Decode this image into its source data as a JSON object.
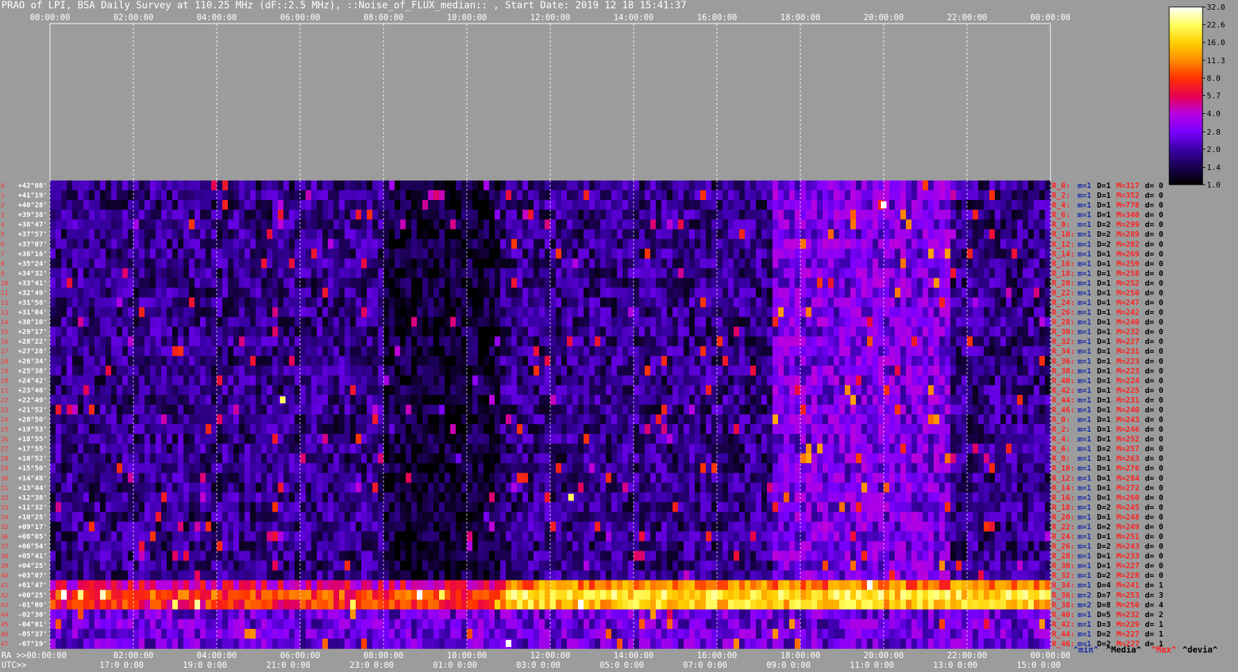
{
  "title": "PRAO of LPI, BSA Daily Survey at 110.25 MHz (dF::2.5 MHz), ::Noise_of_FLUX_median:: , Start Date: 2019 12 18 15:41:37",
  "chart_data": {
    "type": "heatmap",
    "title": "PRAO of LPI, BSA Daily Survey at 110.25 MHz (dF::2.5 MHz), ::Noise_of_FLUX_median:: , Start Date: 2019 12 18 15:41:37",
    "x_top_ticks": [
      "00:00:00",
      "02:00:00",
      "04:00:00",
      "06:00:00",
      "08:00:00",
      "10:00:00",
      "12:00:00",
      "14:00:00",
      "16:00:00",
      "18:00:00",
      "20:00:00",
      "22:00:00",
      "00:00:00"
    ],
    "x_ra_ticks": [
      "02:00:00",
      "04:00:00",
      "06:00:00",
      "08:00:00",
      "10:00:00",
      "12:00:00",
      "14:00:00",
      "16:00:00",
      "18:00:00",
      "20:00:00",
      "22:00:00",
      "00:00:00"
    ],
    "ra_axis_prefix": "RA >>00:00:00",
    "x_utc_ticks": [
      "17:0",
      "19:0",
      "21:0",
      "23:0",
      "01:0",
      "03:0",
      "05:0",
      "07:0",
      "09:0",
      "11:0",
      "13:0",
      "15:0"
    ],
    "x_utc_suffix": "0:00",
    "utc_axis_prefix": "UTC>>",
    "declinations": [
      "+42°08'",
      "+41°19'",
      "+40°28'",
      "+39°38'",
      "+38°47'",
      "+37°57'",
      "+37°07'",
      "+36°16'",
      "+35°24'",
      "+34°32'",
      "+33°41'",
      "+32°49'",
      "+31°56'",
      "+31°04'",
      "+30°10'",
      "+29°17'",
      "+28°22'",
      "+27°28'",
      "+26°34'",
      "+25°38'",
      "+24°42'",
      "+23°46'",
      "+22°49'",
      "+21°52'",
      "+20°50'",
      "+19°53'",
      "+18°55'",
      "+17°55'",
      "+16°52'",
      "+15°50'",
      "+14°48'",
      "+13°44'",
      "+12°38'",
      "+11°32'",
      "+10°25'",
      "+09°17'",
      "+08°05'",
      "+06°54'",
      "+05°41'",
      "+04°25'",
      "+03°07'",
      "+01°47'",
      "+00°25'",
      "-01°00'",
      "-02°30'",
      "-04°01'",
      "-05°37'",
      "-07°19'"
    ],
    "row_indices": [
      "0",
      "1",
      "2",
      "3",
      "4",
      "5",
      "6",
      "7",
      "8",
      "9",
      "10",
      "11",
      "12",
      "13",
      "14",
      "15",
      "16",
      "17",
      "18",
      "19",
      "20",
      "21",
      "22",
      "23",
      "24",
      "25",
      "26",
      "27",
      "28",
      "29",
      "30",
      "31",
      "32",
      "33",
      "34",
      "35",
      "36",
      "37",
      "38",
      "39",
      "40",
      "41",
      "42",
      "43",
      "44",
      "45",
      "46",
      "47"
    ],
    "row_stats": [
      {
        "r": "R_0:",
        "m": "m=1",
        "D": "D=1",
        "M": "M=317",
        "d": "d= 0"
      },
      {
        "r": "R_2:",
        "m": "m=1",
        "D": "D=1",
        "M": "M=352",
        "d": "d= 0"
      },
      {
        "r": "R_4:",
        "m": "m=1",
        "D": "D=1",
        "M": "M=778",
        "d": "d= 0"
      },
      {
        "r": "R_6:",
        "m": "m=1",
        "D": "D=1",
        "M": "M=340",
        "d": "d= 0"
      },
      {
        "r": "R_8:",
        "m": "m=1",
        "D": "D=2",
        "M": "M=299",
        "d": "d= 0"
      },
      {
        "r": "R_10:",
        "m": "m=1",
        "D": "D=2",
        "M": "M=289",
        "d": "d= 0"
      },
      {
        "r": "R_12:",
        "m": "m=1",
        "D": "D=2",
        "M": "M=282",
        "d": "d= 0"
      },
      {
        "r": "R_14:",
        "m": "m=1",
        "D": "D=1",
        "M": "M=269",
        "d": "d= 0"
      },
      {
        "r": "R_16:",
        "m": "m=1",
        "D": "D=1",
        "M": "M=259",
        "d": "d= 0"
      },
      {
        "r": "R_18:",
        "m": "m=1",
        "D": "D=1",
        "M": "M=258",
        "d": "d= 0"
      },
      {
        "r": "R_20:",
        "m": "m=1",
        "D": "D=1",
        "M": "M=252",
        "d": "d= 0"
      },
      {
        "r": "R_22:",
        "m": "m=1",
        "D": "D=1",
        "M": "M=250",
        "d": "d= 0"
      },
      {
        "r": "R_24:",
        "m": "m=1",
        "D": "D=1",
        "M": "M=247",
        "d": "d= 0"
      },
      {
        "r": "R_26:",
        "m": "m=1",
        "D": "D=1",
        "M": "M=242",
        "d": "d= 0"
      },
      {
        "r": "R_28:",
        "m": "m=1",
        "D": "D=1",
        "M": "M=240",
        "d": "d= 0"
      },
      {
        "r": "R_30:",
        "m": "m=1",
        "D": "D=1",
        "M": "M=232",
        "d": "d= 0"
      },
      {
        "r": "R_32:",
        "m": "m=1",
        "D": "D=1",
        "M": "M=227",
        "d": "d= 0"
      },
      {
        "r": "R_34:",
        "m": "m=1",
        "D": "D=1",
        "M": "M=231",
        "d": "d= 0"
      },
      {
        "r": "R_36:",
        "m": "m=1",
        "D": "D=1",
        "M": "M=223",
        "d": "d= 0"
      },
      {
        "r": "R_38:",
        "m": "m=1",
        "D": "D=1",
        "M": "M=223",
        "d": "d= 0"
      },
      {
        "r": "R_40:",
        "m": "m=1",
        "D": "D=1",
        "M": "M=224",
        "d": "d= 0"
      },
      {
        "r": "R_42:",
        "m": "m=1",
        "D": "D=1",
        "M": "M=225",
        "d": "d= 0"
      },
      {
        "r": "R_44:",
        "m": "m=1",
        "D": "D=1",
        "M": "M=231",
        "d": "d= 0"
      },
      {
        "r": "R_46:",
        "m": "m=1",
        "D": "D=1",
        "M": "M=240",
        "d": "d= 0"
      },
      {
        "r": "R_0:",
        "m": "m=1",
        "D": "D=1",
        "M": "M=243",
        "d": "d= 0"
      },
      {
        "r": "R_2:",
        "m": "m=1",
        "D": "D=1",
        "M": "M=246",
        "d": "d= 0"
      },
      {
        "r": "R_4:",
        "m": "m=1",
        "D": "D=1",
        "M": "M=252",
        "d": "d= 0"
      },
      {
        "r": "R_6:",
        "m": "m=1",
        "D": "D=2",
        "M": "M=257",
        "d": "d= 0"
      },
      {
        "r": "R_8:",
        "m": "m=1",
        "D": "D=1",
        "M": "M=263",
        "d": "d= 0"
      },
      {
        "r": "R_10:",
        "m": "m=1",
        "D": "D=1",
        "M": "M=276",
        "d": "d= 0"
      },
      {
        "r": "R_12:",
        "m": "m=1",
        "D": "D=1",
        "M": "M=284",
        "d": "d= 0"
      },
      {
        "r": "R_14:",
        "m": "m=1",
        "D": "D=1",
        "M": "M=272",
        "d": "d= 0"
      },
      {
        "r": "R_16:",
        "m": "m=1",
        "D": "D=1",
        "M": "M=260",
        "d": "d= 0"
      },
      {
        "r": "R_18:",
        "m": "m=1",
        "D": "D=2",
        "M": "M=245",
        "d": "d= 0"
      },
      {
        "r": "R_20:",
        "m": "m=1",
        "D": "D=1",
        "M": "M=248",
        "d": "d= 0"
      },
      {
        "r": "R_22:",
        "m": "m=1",
        "D": "D=2",
        "M": "M=249",
        "d": "d= 0"
      },
      {
        "r": "R_24:",
        "m": "m=1",
        "D": "D=1",
        "M": "M=251",
        "d": "d= 0"
      },
      {
        "r": "R_26:",
        "m": "m=1",
        "D": "D=2",
        "M": "M=243",
        "d": "d= 0"
      },
      {
        "r": "R_28:",
        "m": "m=1",
        "D": "D=1",
        "M": "M=233",
        "d": "d= 0"
      },
      {
        "r": "R_30:",
        "m": "m=1",
        "D": "D=1",
        "M": "M=227",
        "d": "d= 0"
      },
      {
        "r": "R_32:",
        "m": "m=1",
        "D": "D=2",
        "M": "M=228",
        "d": "d= 0"
      },
      {
        "r": "R_34:",
        "m": "m=1",
        "D": "D=4",
        "M": "M=241",
        "d": "d= 1"
      },
      {
        "r": "R_36:",
        "m": "m=2",
        "D": "D=7",
        "M": "M=253",
        "d": "d= 3"
      },
      {
        "r": "R_38:",
        "m": "m=2",
        "D": "D=8",
        "M": "M=250",
        "d": "d= 4"
      },
      {
        "r": "R_40:",
        "m": "m=1",
        "D": "D=5",
        "M": "M=232",
        "d": "d= 2"
      },
      {
        "r": "R_42:",
        "m": "m=1",
        "D": "D=3",
        "M": "M=229",
        "d": "d= 1"
      },
      {
        "r": "R_44:",
        "m": "m=1",
        "D": "D=2",
        "M": "M=227",
        "d": "d= 1"
      },
      {
        "r": "R_46:",
        "m": "m=1",
        "D": "D=2",
        "M": "M=227",
        "d": "d= 1"
      }
    ],
    "stat_legend": {
      "min": "^min^",
      "media": "^Media^",
      "max": "^Max^",
      "devia": "^devia^"
    },
    "colorbar_ticks": [
      "32.0",
      "22.6",
      "16.0",
      "11.3",
      "8.0",
      "5.7",
      "4.0",
      "2.8",
      "2.0",
      "1.4",
      "1.0"
    ],
    "colorbar_range": [
      1.0,
      32.0
    ],
    "colorbar_scale": "log",
    "colormap": [
      "#000000",
      "#1a0050",
      "#3a00a8",
      "#7a00ff",
      "#b800e0",
      "#e8004c",
      "#ff3300",
      "#ff8c00",
      "#ffd000",
      "#ffff60",
      "#ffffff"
    ],
    "band_profile": [
      {
        "rows": [
          0,
          40
        ],
        "base": 1.6
      },
      {
        "rows": [
          41,
          41
        ],
        "base": 4.5
      },
      {
        "rows": [
          42,
          42
        ],
        "base": 7.5
      },
      {
        "rows": [
          43,
          43
        ],
        "base": 6.5
      },
      {
        "rows": [
          44,
          47
        ],
        "base": 2.4
      }
    ],
    "bright_sources": [
      {
        "ra": "20:00",
        "dec": "+40°28'",
        "value": 32.0
      },
      {
        "ra": "05:35",
        "dec": "+22°49'",
        "value": 22.6
      },
      {
        "ra": "12:30",
        "dec": "+12°38'",
        "value": 22.6
      },
      {
        "ra": "11:00",
        "dec": "-07°19'",
        "value": 32.0
      }
    ]
  }
}
